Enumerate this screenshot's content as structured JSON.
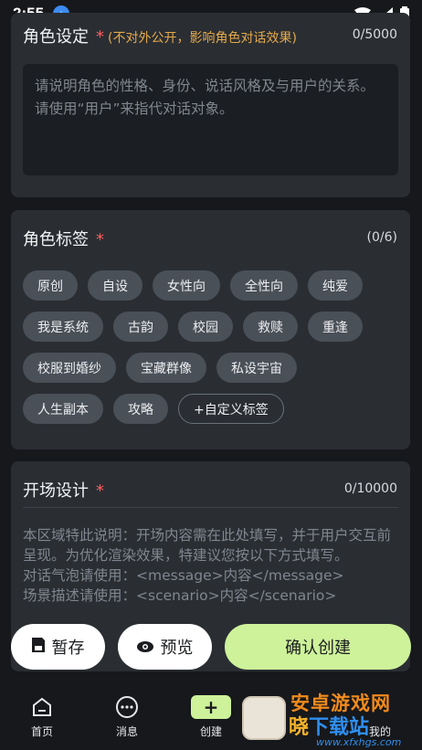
{
  "statusbar": {
    "time": "2:55"
  },
  "role_setting": {
    "title": "角色设定",
    "required_mark": "*",
    "hint": "(不对外公开，影响角色对话效果)",
    "counter": "0/5000",
    "placeholder_line1": "请说明角色的性格、身份、说话风格及与用户的关系。",
    "placeholder_line2": "请使用“用户”来指代对话对象。"
  },
  "role_tags": {
    "title": "角色标签",
    "required_mark": "*",
    "counter": "(0/6)",
    "rows": [
      [
        "原创",
        "自设",
        "女性向",
        "全性向",
        "纯爱"
      ],
      [
        "我是系统",
        "古韵",
        "校园",
        "救赎",
        "重逢"
      ],
      [
        "校服到婚纱",
        "宝藏群像",
        "私设宇宙"
      ],
      [
        "人生副本",
        "攻略"
      ]
    ],
    "custom_tag": "+自定义标签"
  },
  "opening": {
    "title": "开场设计",
    "required_mark": "*",
    "counter": "0/10000",
    "placeholder": "本区域特此说明：开场内容需在此处填写，并于用户交互前呈现。为优化渲染效果，特建议您按以下方式填写。\n对话气泡请使用：<message>内容</message>\n场景描述请使用：<scenario>内容</scenario>"
  },
  "actions": {
    "save": "暂存",
    "preview": "预览",
    "confirm": "确认创建"
  },
  "tabbar": {
    "home": "首页",
    "messages": "消息",
    "create": "创建",
    "me": "我的"
  },
  "watermark": {
    "line1": "安卓游戏网",
    "line2a": "晓",
    "line2b": "下载站",
    "url": "www.xfxhgs.com"
  }
}
